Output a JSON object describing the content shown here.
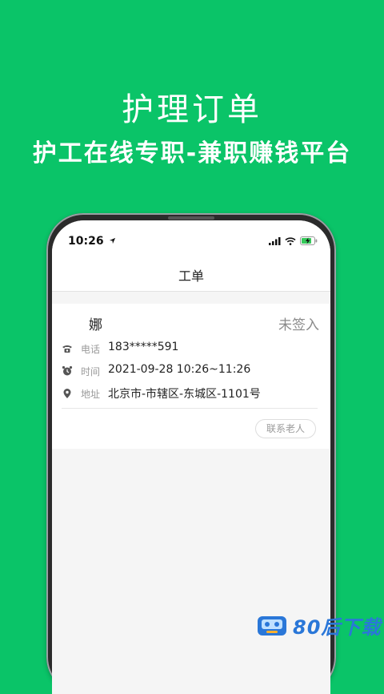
{
  "banner": {
    "headline": "护理订单",
    "subheadline": "护工在线专职-兼职赚钱平台"
  },
  "status_bar": {
    "time": "10:26"
  },
  "nav": {
    "title": "工单"
  },
  "order": {
    "name": "娜",
    "status": "未签入",
    "phone_label": "电话",
    "phone": "183*****591",
    "time_label": "时间",
    "time": "2021-09-28 10:26~11:26",
    "address_label": "地址",
    "address": "北京市-市辖区-东城区-1101号",
    "contact_button": "联系老人"
  },
  "watermark": {
    "text": "80后下载"
  },
  "colors": {
    "background_green": "#0ac468",
    "watermark_blue": "#2a77d8",
    "status_gray": "#8a8a8a"
  },
  "icons": {
    "phone": "telephone-icon",
    "time": "alarm-clock-icon",
    "address": "location-pin-icon",
    "location_arrow": "location-arrow-icon",
    "signal": "cellular-signal-icon",
    "wifi": "wifi-icon",
    "battery": "battery-charging-icon"
  }
}
